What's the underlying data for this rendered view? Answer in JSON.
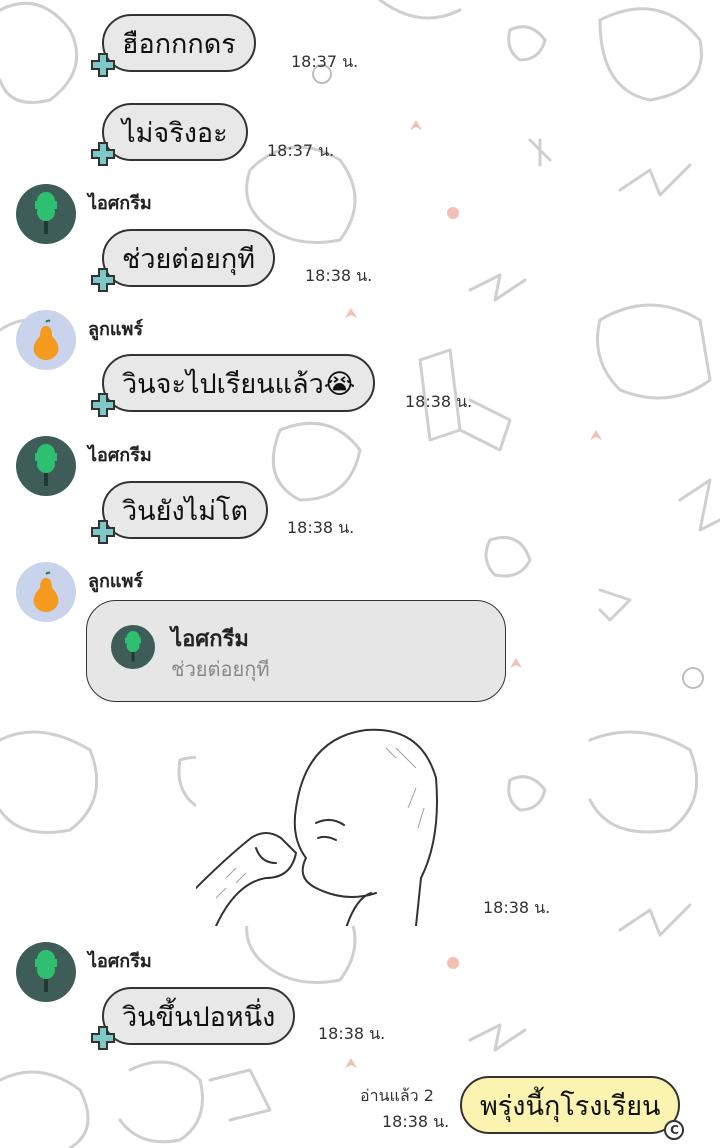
{
  "colors": {
    "bubble_other": "#e8e8e8",
    "bubble_mine": "#fbf3b0",
    "avatar_icecream_bg": "#3f5d58",
    "avatar_pear_bg": "#c9d3ec",
    "pear": "#f39a1f",
    "badge_teal": "#7ec8c8"
  },
  "messages": [
    {
      "text": "ฮือกกกดร",
      "time": "18:37 น."
    },
    {
      "text": "ไม่จริงอะ",
      "time": "18:37 น."
    },
    {
      "sender": "ไอศกรีม",
      "avatar_icon": "icecream-icon",
      "text": "ช่วยต่อยกุที",
      "time": "18:38 น."
    },
    {
      "sender": "ลูกแพร์",
      "avatar_icon": "pear-icon",
      "text": "วินจะไปเรียนแล้ว😭",
      "time": "18:38 น."
    },
    {
      "sender": "ไอศกรีม",
      "avatar_icon": "icecream-icon",
      "text": "วินยังไม่โต",
      "time": "18:38 น."
    },
    {
      "sender": "ลูกแพร์",
      "avatar_icon": "pear-icon",
      "reply": {
        "name": "ไอศกรีม",
        "text": "ช่วยต่อยกุที"
      }
    },
    {
      "sticker": "bald-man-sticker",
      "time": "18:38 น."
    },
    {
      "sender": "ไอศกรีม",
      "avatar_icon": "icecream-icon",
      "text": "วินขึ้นปอหนึ่ง",
      "time": "18:38 น."
    }
  ],
  "own_message": {
    "text": "พรุ่งนี้กุโรงเรียน",
    "read": "อ่านแล้ว 2",
    "time": "18:38 น.",
    "badge": "C"
  }
}
